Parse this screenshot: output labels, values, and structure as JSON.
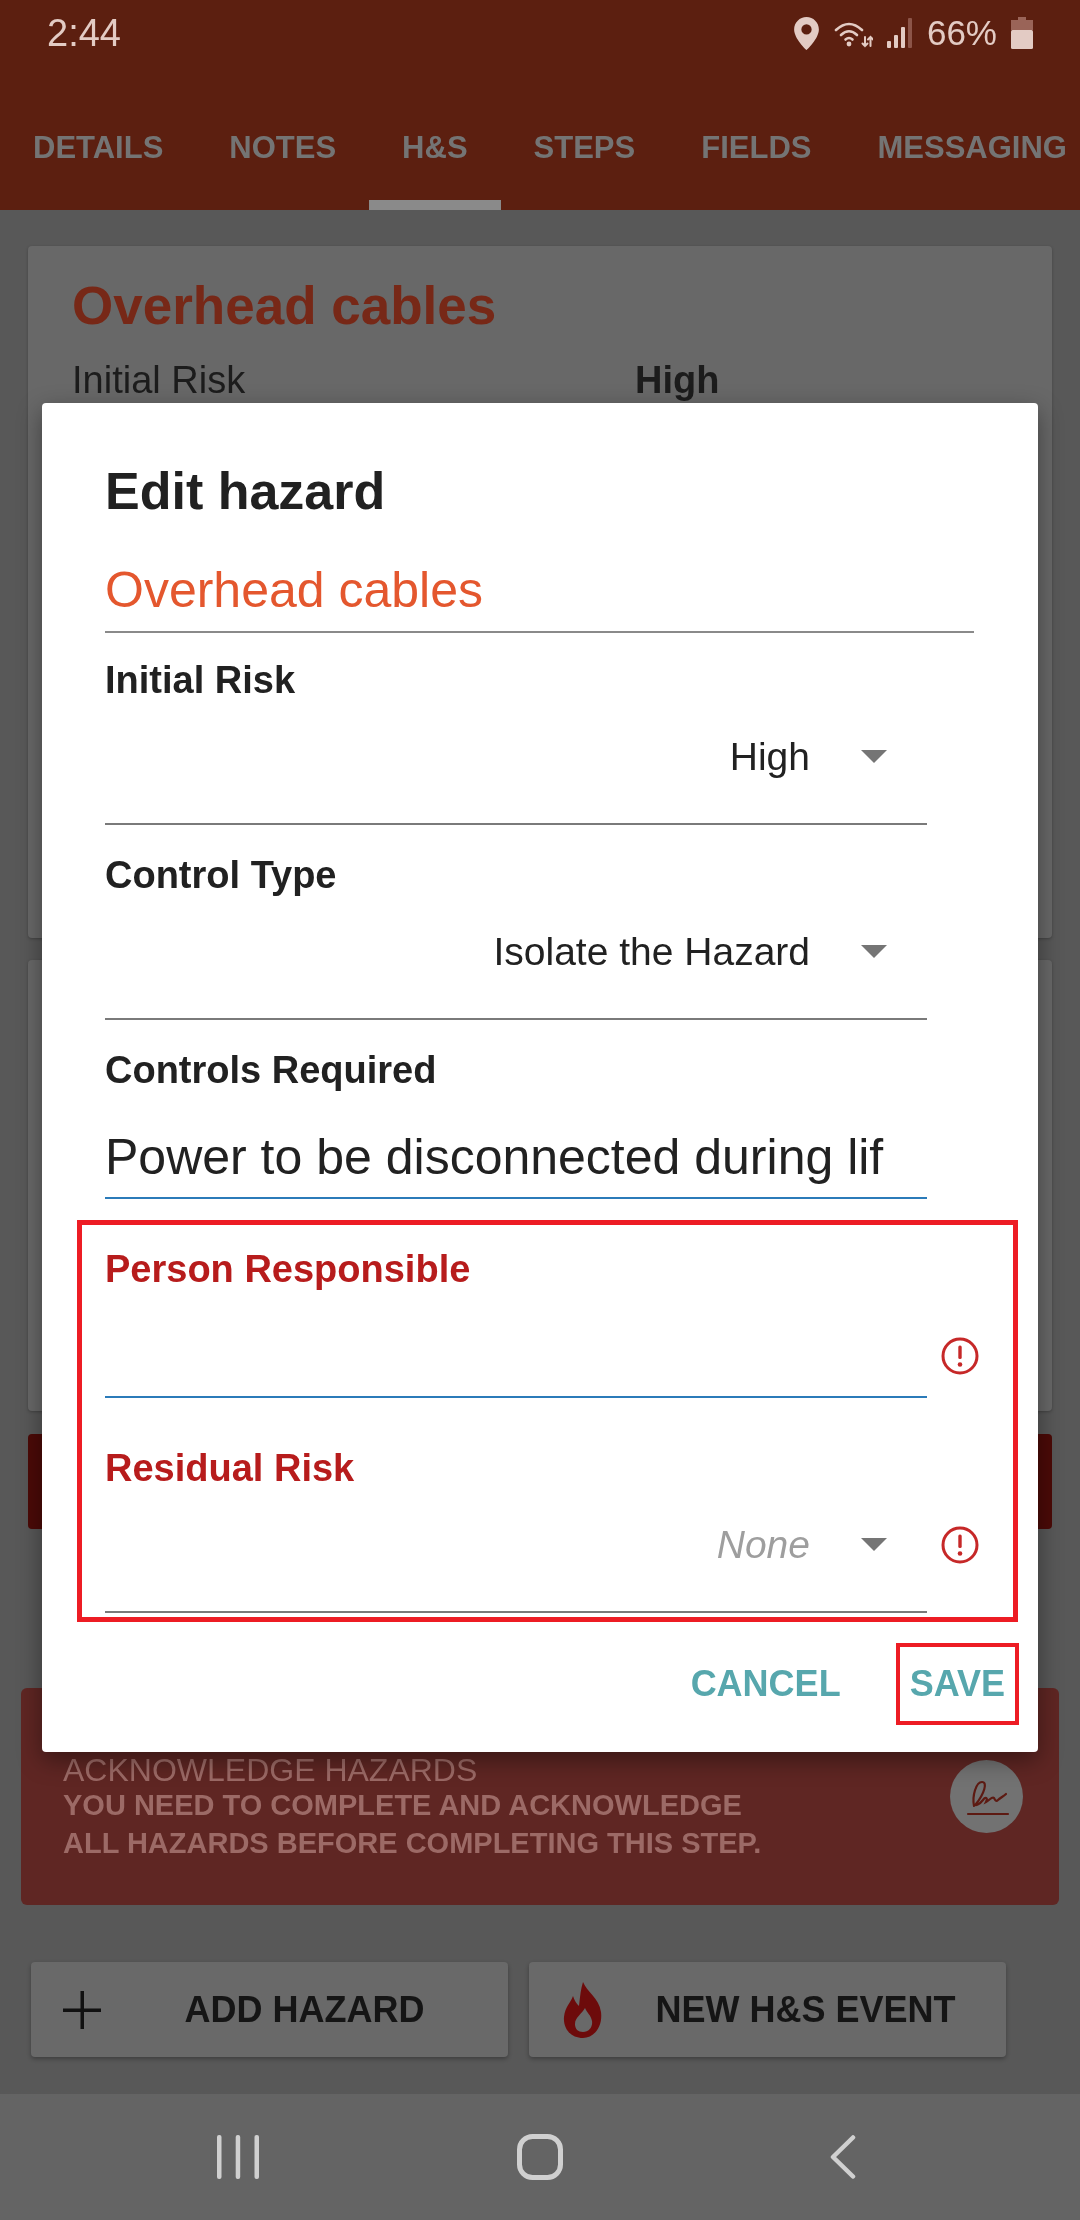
{
  "status_bar": {
    "time": "2:44",
    "battery": "66%"
  },
  "tabs": [
    {
      "label": "DETAILS",
      "selected": false
    },
    {
      "label": "NOTES",
      "selected": false
    },
    {
      "label": "H&S",
      "selected": true
    },
    {
      "label": "STEPS",
      "selected": false
    },
    {
      "label": "FIELDS",
      "selected": false
    },
    {
      "label": "MESSAGING",
      "selected": false
    }
  ],
  "hazard_card": {
    "title": "Overhead cables",
    "rows": [
      {
        "label": "Initial Risk",
        "value": "High"
      }
    ]
  },
  "acknowledge_banner": {
    "title": "ACKNOWLEDGE HAZARDS",
    "message": "YOU NEED TO COMPLETE AND ACKNOWLEDGE\nALL HAZARDS BEFORE COMPLETING THIS STEP."
  },
  "bottom_buttons": [
    {
      "kind": "add",
      "label": "ADD HAZARD"
    },
    {
      "kind": "event",
      "label": "NEW H&S EVENT"
    }
  ],
  "dialog": {
    "title": "Edit hazard",
    "name": "Overhead cables",
    "fields": [
      {
        "kind": "select",
        "label": "Initial Risk",
        "value": "High",
        "error": false,
        "highlighted": false
      },
      {
        "kind": "select",
        "label": "Control Type",
        "value": "Isolate the Hazard",
        "error": false,
        "highlighted": false
      },
      {
        "kind": "text",
        "label": "Controls Required",
        "value": "Power to be disconnected during lif",
        "error": false,
        "highlighted": false
      },
      {
        "kind": "text",
        "label": "Person Responsible",
        "error": true,
        "highlighted": true
      },
      {
        "kind": "select",
        "label": "Residual Risk",
        "placeholder": "None",
        "error": true,
        "highlighted": true
      }
    ],
    "actions": [
      {
        "label": "CANCEL",
        "highlighted": false
      },
      {
        "label": "SAVE",
        "highlighted": true
      }
    ]
  }
}
